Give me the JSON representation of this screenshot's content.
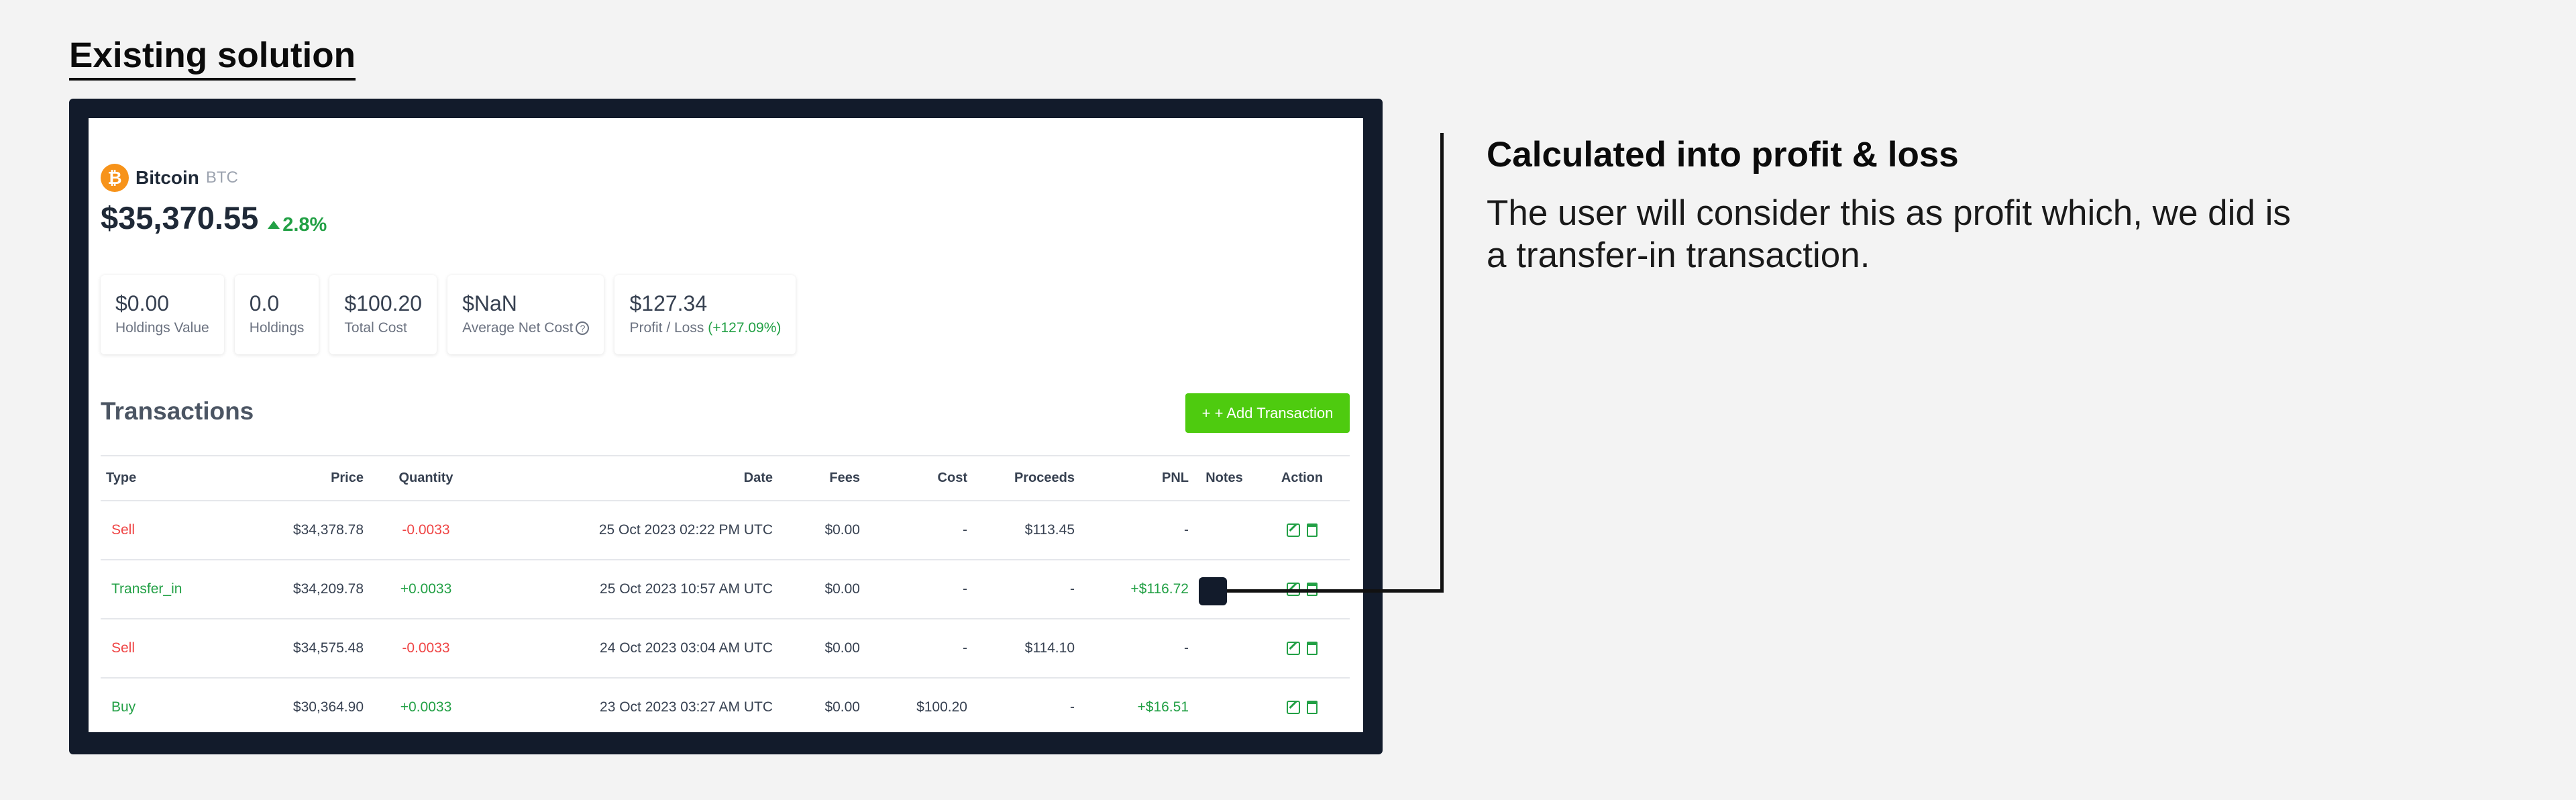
{
  "section_title": "Existing solution",
  "coin": {
    "logo_glyph": "₿",
    "name": "Bitcoin",
    "symbol": "BTC",
    "price": "$35,370.55",
    "change": "2.8%"
  },
  "stats": [
    {
      "value": "$0.00",
      "label": "Holdings Value"
    },
    {
      "value": "0.0",
      "label": "Holdings"
    },
    {
      "value": "$100.20",
      "label": "Total Cost"
    },
    {
      "value": "$NaN",
      "label": "Average Net Cost"
    },
    {
      "value": "$127.34",
      "label": "Profit / Loss",
      "pct": "(+127.09%)"
    }
  ],
  "transactions": {
    "title": "Transactions",
    "add_button": "+ + Add Transaction",
    "headers": [
      "Type",
      "Price",
      "Quantity",
      "Date",
      "Fees",
      "Cost",
      "Proceeds",
      "PNL",
      "Notes",
      "Action"
    ],
    "rows": [
      {
        "type": "Sell",
        "price": "$34,378.78",
        "quantity": "-0.0033",
        "date": "25 Oct 2023 02:22 PM UTC",
        "fees": "$0.00",
        "cost": "-",
        "proceeds": "$113.45",
        "pnl": "-",
        "notes": ""
      },
      {
        "type": "Transfer_in",
        "price": "$34,209.78",
        "quantity": "+0.0033",
        "date": "25 Oct 2023 10:57 AM UTC",
        "fees": "$0.00",
        "cost": "-",
        "proceeds": "-",
        "pnl": "+$116.72",
        "notes": ""
      },
      {
        "type": "Sell",
        "price": "$34,575.48",
        "quantity": "-0.0033",
        "date": "24 Oct 2023 03:04 AM UTC",
        "fees": "$0.00",
        "cost": "-",
        "proceeds": "$114.10",
        "pnl": "-",
        "notes": ""
      },
      {
        "type": "Buy",
        "price": "$30,364.90",
        "quantity": "+0.0033",
        "date": "23 Oct 2023 03:27 AM UTC",
        "fees": "$0.00",
        "cost": "$100.20",
        "proceeds": "-",
        "pnl": "+$16.51",
        "notes": ""
      }
    ]
  },
  "annotation": {
    "title": "Calculated into profit & loss",
    "body": "The user will consider this as profit which, we did is a transfer-in transaction."
  },
  "colors": {
    "frame": "#121b2b",
    "accent_green": "#22a045",
    "button_green": "#4ecb0f",
    "sell_red": "#ef4444",
    "bitcoin_orange": "#f7931a"
  }
}
